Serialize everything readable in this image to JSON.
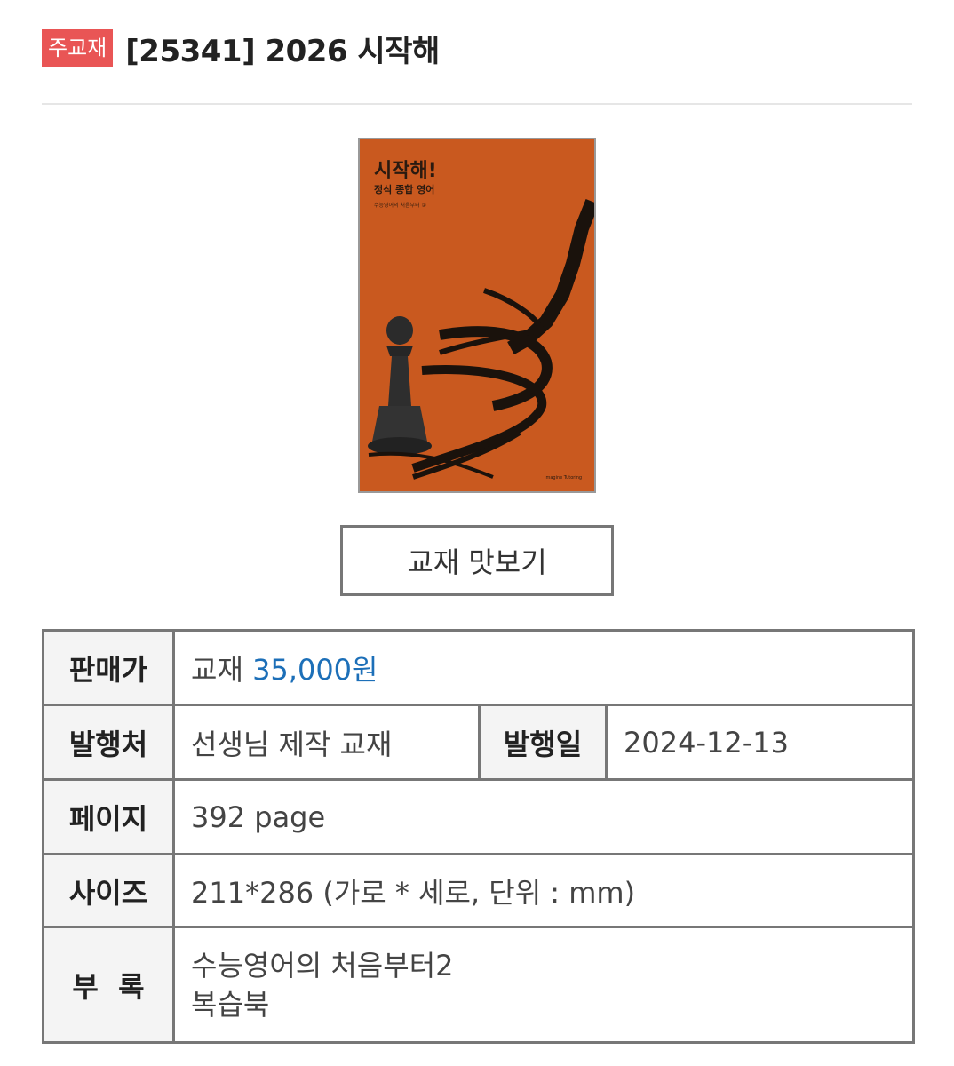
{
  "header": {
    "badge": "주교재",
    "title": "[25341] 2026 시작해"
  },
  "cover": {
    "title": "시작해!",
    "subtitle": "정식 종합 영어",
    "tagline": "수능영어의 처음부터 ②",
    "background_color": "#c9591f"
  },
  "preview_button": {
    "label": "교재 맛보기"
  },
  "info": {
    "price_label": "판매가",
    "price_prefix": "교재",
    "price_value": "35,000원",
    "price_color": "#1c6fb8",
    "publisher_label": "발행처",
    "publisher_value": "선생님 제작 교재",
    "date_label": "발행일",
    "date_value": "2024-12-13",
    "pages_label": "페이지",
    "pages_value": "392 page",
    "size_label": "사이즈",
    "size_value": "211*286 (가로 * 세로, 단위 : mm)",
    "appendix_label": "부  록",
    "appendix_lines": [
      "수능영어의 처음부터2",
      "복습북"
    ]
  }
}
